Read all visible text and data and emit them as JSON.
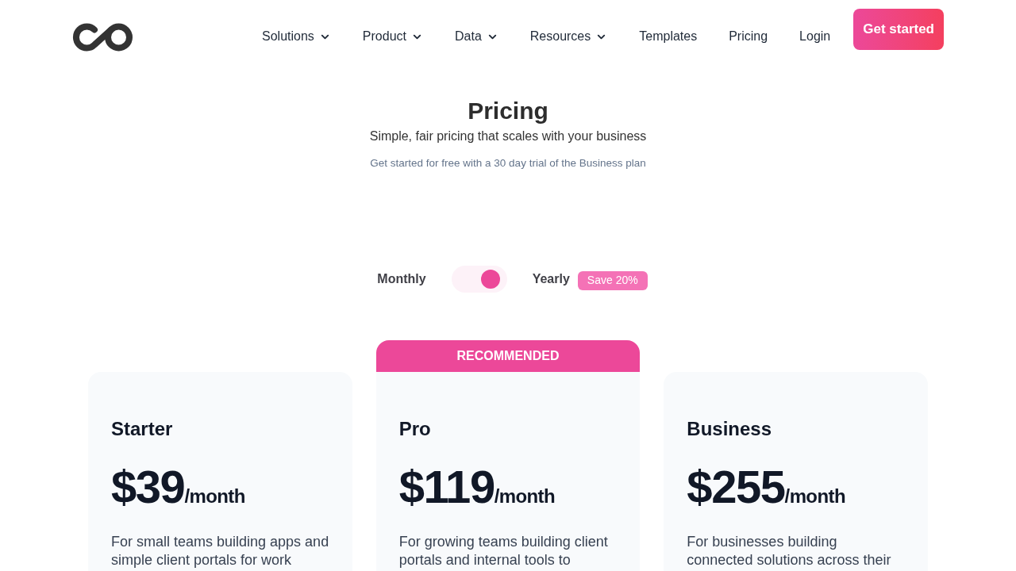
{
  "header": {
    "nav": [
      {
        "label": "Solutions",
        "has_menu": true
      },
      {
        "label": "Product",
        "has_menu": true
      },
      {
        "label": "Data",
        "has_menu": true
      },
      {
        "label": "Resources",
        "has_menu": true
      },
      {
        "label": "Templates",
        "has_menu": false
      },
      {
        "label": "Pricing",
        "has_menu": false
      },
      {
        "label": "Login",
        "has_menu": false
      }
    ],
    "cta": "Get started"
  },
  "hero": {
    "title": "Pricing",
    "subtitle": "Simple, fair pricing that scales with your business",
    "note": "Get started for free with a 30 day trial of the Business plan"
  },
  "billing": {
    "monthly_label": "Monthly",
    "yearly_label": "Yearly",
    "on": true,
    "badge": "Save 20%"
  },
  "plans": [
    {
      "name": "Starter",
      "price": "$39",
      "period": "/month",
      "description": "For small teams building apps and simple client portals for work"
    },
    {
      "ribbon": "RECOMMENDED",
      "name": "Pro",
      "price": "$119",
      "period": "/month",
      "description": "For growing teams building client portals and internal tools to"
    },
    {
      "name": "Business",
      "price": "$255",
      "period": "/month",
      "description": "For businesses building connected solutions across their"
    }
  ]
}
